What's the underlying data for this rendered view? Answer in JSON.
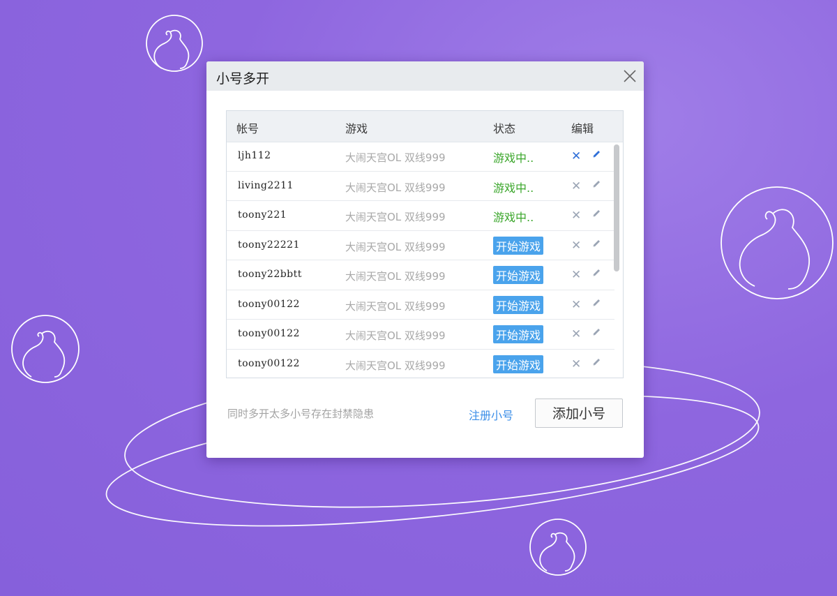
{
  "dialog": {
    "title": "小号多开",
    "close_icon": "close-icon"
  },
  "table": {
    "headers": {
      "account": "帐号",
      "game": "游戏",
      "status": "状态",
      "edit": "编辑"
    },
    "rows": [
      {
        "account": "ljh112",
        "game": "大闹天宫OL 双线999",
        "status": "游戏中..",
        "status_type": "playing",
        "delete_active": true
      },
      {
        "account": "living2211",
        "game": "大闹天宫OL 双线999",
        "status": "游戏中..",
        "status_type": "playing",
        "delete_active": false
      },
      {
        "account": "toony221",
        "game": "大闹天宫OL 双线999",
        "status": "游戏中..",
        "status_type": "playing",
        "delete_active": false
      },
      {
        "account": "toony22221",
        "game": "大闹天宫OL 双线999",
        "status": "开始游戏",
        "status_type": "start",
        "delete_active": false
      },
      {
        "account": "toony22bbtt",
        "game": "大闹天宫OL 双线999",
        "status": "开始游戏",
        "status_type": "start",
        "delete_active": false
      },
      {
        "account": "toony00122",
        "game": "大闹天宫OL 双线999",
        "status": "开始游戏",
        "status_type": "start",
        "delete_active": false
      },
      {
        "account": "toony00122",
        "game": "大闹天宫OL 双线999",
        "status": "开始游戏",
        "status_type": "start",
        "delete_active": false
      },
      {
        "account": "toony00122",
        "game": "大闹天宫OL 双线999",
        "status": "开始游戏",
        "status_type": "start",
        "delete_active": false
      }
    ]
  },
  "footer": {
    "warning": "同时多开太多小号存在封禁隐患",
    "register_link": "注册小号",
    "add_button": "添加小号"
  },
  "colors": {
    "background": "#8e66df",
    "playing": "#3aa62a",
    "start_button": "#4aa3ec",
    "link": "#3b8ee8"
  },
  "icons": {
    "delete": "close-x-icon",
    "edit": "pencil-icon",
    "decoration": "gourd-logo-icon"
  }
}
